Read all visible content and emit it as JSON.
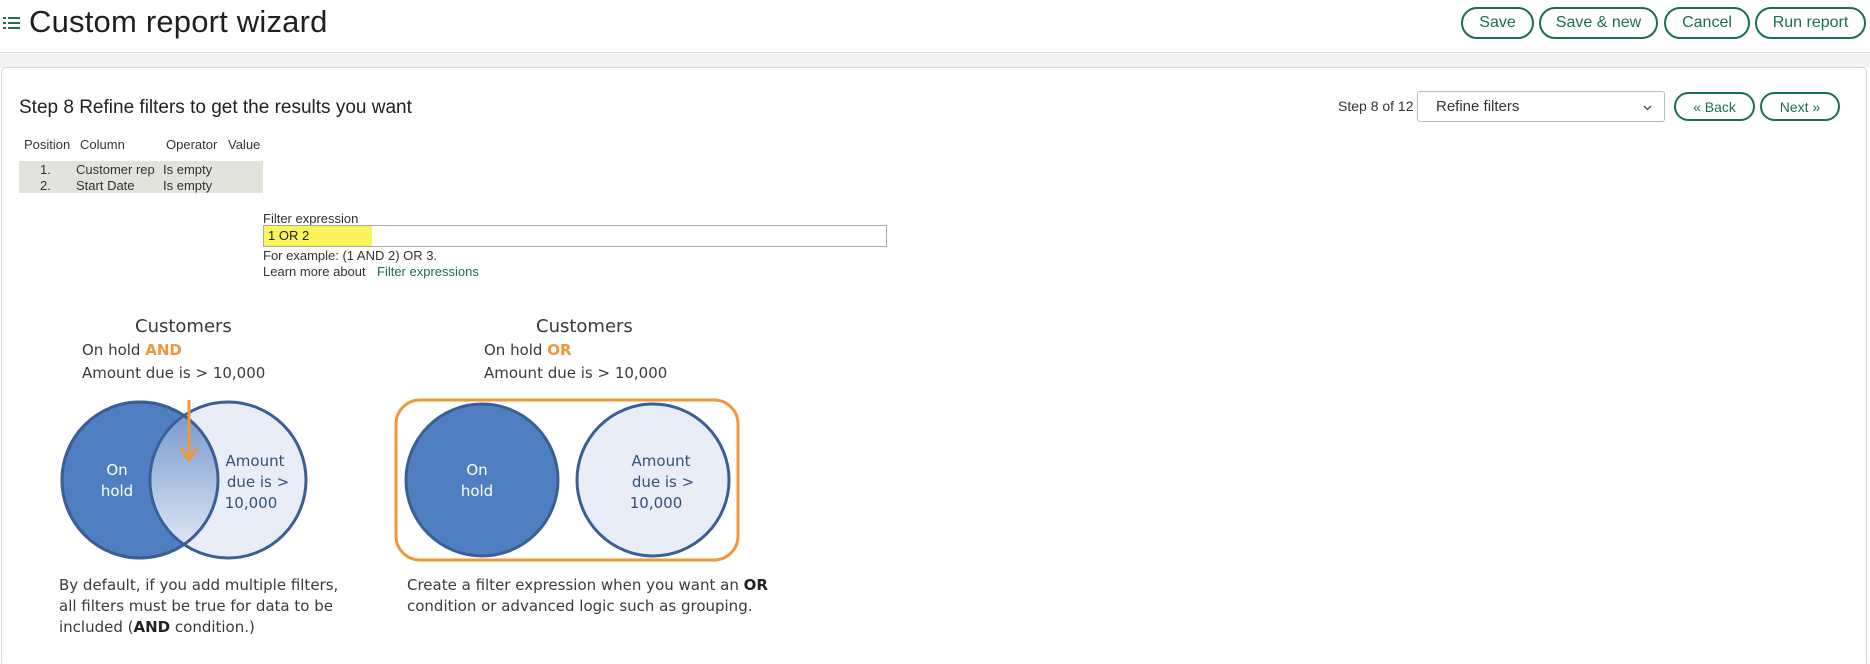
{
  "header": {
    "title": "Custom report wizard",
    "buttons": {
      "save": "Save",
      "save_new": "Save & new",
      "cancel": "Cancel",
      "run": "Run report"
    }
  },
  "step": {
    "title": "Step 8 Refine filters to get the results you want",
    "count": "Step 8 of 12",
    "selected": "Refine filters",
    "back": "« Back",
    "next": "Next »"
  },
  "filters": {
    "columns": [
      "Position",
      "Column",
      "Operator",
      "Value"
    ],
    "rows": [
      {
        "position": "1.",
        "column": "Customer rep",
        "operator": "Is empty",
        "value": ""
      },
      {
        "position": "2.",
        "column": "Start Date",
        "operator": "Is empty",
        "value": ""
      }
    ]
  },
  "filter_expression": {
    "label": "Filter expression",
    "value": "1 OR 2",
    "example": "For example: (1 AND 2) OR 3.",
    "learn_prefix": "Learn more about",
    "learn_link": "Filter expressions"
  },
  "diagram_and": {
    "title": "Customers",
    "line1_prefix": "On hold ",
    "line1_keyword": "AND",
    "line2": "Amount due is > 10,000",
    "left_circle": [
      "On",
      "hold"
    ],
    "right_circle": [
      "Amount",
      "due is >",
      "10,000"
    ],
    "caption_line1": "By default, if you add multiple filters,",
    "caption_line2": "all filters must be true for data to be",
    "caption_line3_prefix": "included (",
    "caption_line3_keyword": "AND",
    "caption_line3_suffix": " condition.)"
  },
  "diagram_or": {
    "title": "Customers",
    "line1_prefix": "On hold ",
    "line1_keyword": "OR",
    "line2": "Amount due is > 10,000",
    "left_circle": [
      "On",
      "hold"
    ],
    "right_circle": [
      "Amount",
      "due is >",
      "10,000"
    ],
    "caption_line1_prefix": "Create a filter expression when you want an ",
    "caption_line1_keyword": "OR",
    "caption_line2": "condition or advanced logic such as grouping."
  },
  "colors": {
    "accent_green": "#1b6f4a",
    "orange": "#f0963c",
    "circle_dark": "#4f7fc0",
    "circle_light": "#e8edf8",
    "highlight": "#fbf35a"
  }
}
